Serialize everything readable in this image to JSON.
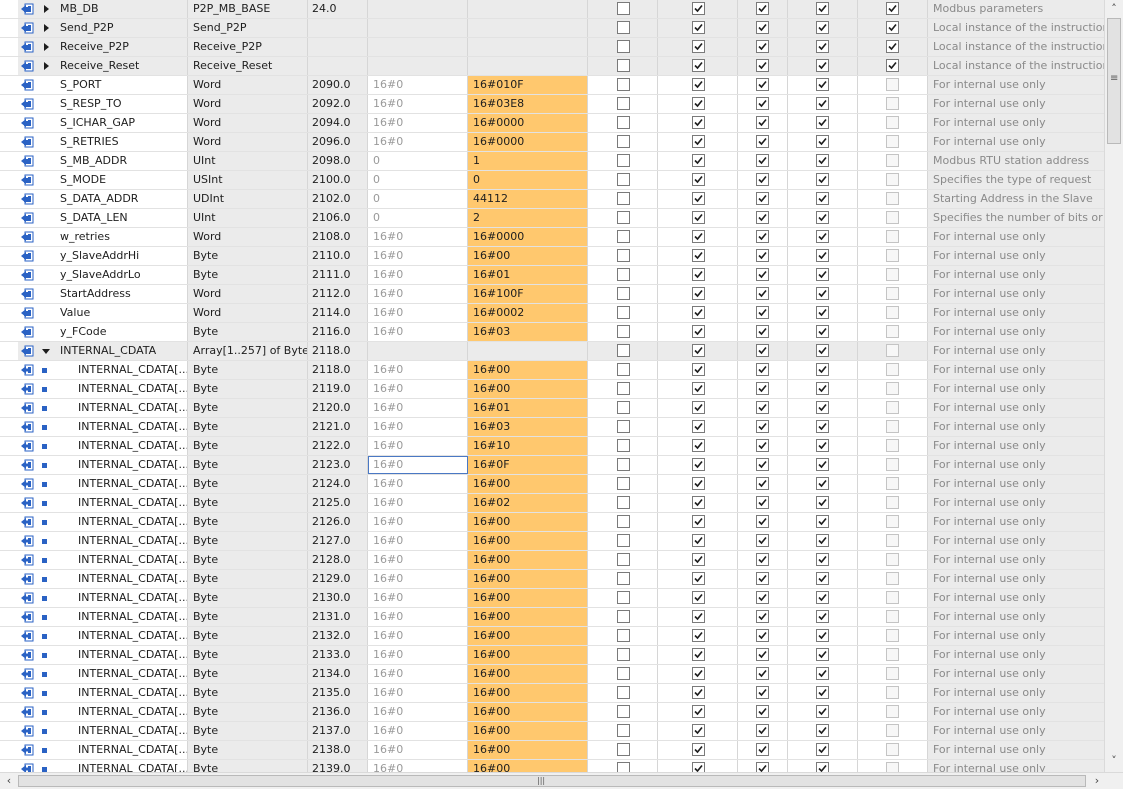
{
  "rows": [
    {
      "name": "MB_DB",
      "type": "P2P_MB_BASE",
      "offset": "24.0",
      "start": "",
      "snapshot": "",
      "expand": "right",
      "indent": 0,
      "checks": [
        false,
        true,
        true,
        true,
        true
      ],
      "setpoint_enabled": true,
      "comment": "Modbus parameters",
      "header": true
    },
    {
      "name": "Send_P2P",
      "type": "Send_P2P",
      "offset": "",
      "start": "",
      "snapshot": "",
      "expand": "right",
      "indent": 0,
      "checks": [
        false,
        true,
        true,
        true,
        true
      ],
      "setpoint_enabled": true,
      "comment": "Local instance of the instruction",
      "header": true
    },
    {
      "name": "Receive_P2P",
      "type": "Receive_P2P",
      "offset": "",
      "start": "",
      "snapshot": "",
      "expand": "right",
      "indent": 0,
      "checks": [
        false,
        true,
        true,
        true,
        true
      ],
      "setpoint_enabled": true,
      "comment": "Local instance of the instruction",
      "header": true
    },
    {
      "name": "Receive_Reset",
      "type": "Receive_Reset",
      "offset": "",
      "start": "",
      "snapshot": "",
      "expand": "right",
      "indent": 0,
      "checks": [
        false,
        true,
        true,
        true,
        true
      ],
      "setpoint_enabled": true,
      "comment": "Local instance of the instruction",
      "header": true
    },
    {
      "name": "S_PORT",
      "type": "Word",
      "offset": "2090.0",
      "start": "16#0",
      "snapshot": "16#010F",
      "expand": "",
      "indent": 0,
      "checks": [
        false,
        true,
        true,
        true,
        false
      ],
      "setpoint_enabled": false,
      "comment": "For internal use only"
    },
    {
      "name": "S_RESP_TO",
      "type": "Word",
      "offset": "2092.0",
      "start": "16#0",
      "snapshot": "16#03E8",
      "expand": "",
      "indent": 0,
      "checks": [
        false,
        true,
        true,
        true,
        false
      ],
      "setpoint_enabled": false,
      "comment": "For internal use only"
    },
    {
      "name": "S_ICHAR_GAP",
      "type": "Word",
      "offset": "2094.0",
      "start": "16#0",
      "snapshot": "16#0000",
      "expand": "",
      "indent": 0,
      "checks": [
        false,
        true,
        true,
        true,
        false
      ],
      "setpoint_enabled": false,
      "comment": "For internal use only"
    },
    {
      "name": "S_RETRIES",
      "type": "Word",
      "offset": "2096.0",
      "start": "16#0",
      "snapshot": "16#0000",
      "expand": "",
      "indent": 0,
      "checks": [
        false,
        true,
        true,
        true,
        false
      ],
      "setpoint_enabled": false,
      "comment": "For internal use only"
    },
    {
      "name": "S_MB_ADDR",
      "type": "UInt",
      "offset": "2098.0",
      "start": "0",
      "snapshot": "1",
      "expand": "",
      "indent": 0,
      "checks": [
        false,
        true,
        true,
        true,
        false
      ],
      "setpoint_enabled": false,
      "comment": "Modbus RTU station address"
    },
    {
      "name": "S_MODE",
      "type": "USInt",
      "offset": "2100.0",
      "start": "0",
      "snapshot": "0",
      "expand": "",
      "indent": 0,
      "checks": [
        false,
        true,
        true,
        true,
        false
      ],
      "setpoint_enabled": false,
      "comment": "Specifies the type of request"
    },
    {
      "name": "S_DATA_ADDR",
      "type": "UDInt",
      "offset": "2102.0",
      "start": "0",
      "snapshot": "44112",
      "expand": "",
      "indent": 0,
      "checks": [
        false,
        true,
        true,
        true,
        false
      ],
      "setpoint_enabled": false,
      "comment": "Starting Address in the Slave"
    },
    {
      "name": "S_DATA_LEN",
      "type": "UInt",
      "offset": "2106.0",
      "start": "0",
      "snapshot": "2",
      "expand": "",
      "indent": 0,
      "checks": [
        false,
        true,
        true,
        true,
        false
      ],
      "setpoint_enabled": false,
      "comment": "Specifies the number of bits or w"
    },
    {
      "name": "w_retries",
      "type": "Word",
      "offset": "2108.0",
      "start": "16#0",
      "snapshot": "16#0000",
      "expand": "",
      "indent": 0,
      "checks": [
        false,
        true,
        true,
        true,
        false
      ],
      "setpoint_enabled": false,
      "comment": "For internal use only"
    },
    {
      "name": "y_SlaveAddrHi",
      "type": "Byte",
      "offset": "2110.0",
      "start": "16#0",
      "snapshot": "16#00",
      "expand": "",
      "indent": 0,
      "checks": [
        false,
        true,
        true,
        true,
        false
      ],
      "setpoint_enabled": false,
      "comment": "For internal use only"
    },
    {
      "name": "y_SlaveAddrLo",
      "type": "Byte",
      "offset": "2111.0",
      "start": "16#0",
      "snapshot": "16#01",
      "expand": "",
      "indent": 0,
      "checks": [
        false,
        true,
        true,
        true,
        false
      ],
      "setpoint_enabled": false,
      "comment": "For internal use only"
    },
    {
      "name": "StartAddress",
      "type": "Word",
      "offset": "2112.0",
      "start": "16#0",
      "snapshot": "16#100F",
      "expand": "",
      "indent": 0,
      "checks": [
        false,
        true,
        true,
        true,
        false
      ],
      "setpoint_enabled": false,
      "comment": "For internal use only"
    },
    {
      "name": "Value",
      "type": "Word",
      "offset": "2114.0",
      "start": "16#0",
      "snapshot": "16#0002",
      "expand": "",
      "indent": 0,
      "checks": [
        false,
        true,
        true,
        true,
        false
      ],
      "setpoint_enabled": false,
      "comment": "For internal use only"
    },
    {
      "name": "y_FCode",
      "type": "Byte",
      "offset": "2116.0",
      "start": "16#0",
      "snapshot": "16#03",
      "expand": "",
      "indent": 0,
      "checks": [
        false,
        true,
        true,
        true,
        false
      ],
      "setpoint_enabled": false,
      "comment": "For internal use only"
    },
    {
      "name": "INTERNAL_CDATA",
      "type": "Array[1..257] of Byte",
      "offset": "2118.0",
      "start": "",
      "snapshot": "",
      "expand": "down",
      "indent": 0,
      "checks": [
        false,
        true,
        true,
        true,
        false
      ],
      "setpoint_enabled": false,
      "comment": "For internal use only",
      "header": true
    },
    {
      "name": "INTERNAL_CDATA[...",
      "type": "Byte",
      "offset": "2118.0",
      "start": "16#0",
      "snapshot": "16#00",
      "expand": "",
      "indent": 1,
      "checks": [
        false,
        true,
        true,
        true,
        false
      ],
      "setpoint_enabled": false,
      "comment": "For internal use only"
    },
    {
      "name": "INTERNAL_CDATA[...",
      "type": "Byte",
      "offset": "2119.0",
      "start": "16#0",
      "snapshot": "16#00",
      "expand": "",
      "indent": 1,
      "checks": [
        false,
        true,
        true,
        true,
        false
      ],
      "setpoint_enabled": false,
      "comment": "For internal use only"
    },
    {
      "name": "INTERNAL_CDATA[...",
      "type": "Byte",
      "offset": "2120.0",
      "start": "16#0",
      "snapshot": "16#01",
      "expand": "",
      "indent": 1,
      "checks": [
        false,
        true,
        true,
        true,
        false
      ],
      "setpoint_enabled": false,
      "comment": "For internal use only"
    },
    {
      "name": "INTERNAL_CDATA[...",
      "type": "Byte",
      "offset": "2121.0",
      "start": "16#0",
      "snapshot": "16#03",
      "expand": "",
      "indent": 1,
      "checks": [
        false,
        true,
        true,
        true,
        false
      ],
      "setpoint_enabled": false,
      "comment": "For internal use only"
    },
    {
      "name": "INTERNAL_CDATA[...",
      "type": "Byte",
      "offset": "2122.0",
      "start": "16#0",
      "snapshot": "16#10",
      "expand": "",
      "indent": 1,
      "checks": [
        false,
        true,
        true,
        true,
        false
      ],
      "setpoint_enabled": false,
      "comment": "For internal use only"
    },
    {
      "name": "INTERNAL_CDATA[...",
      "type": "Byte",
      "offset": "2123.0",
      "start": "16#0",
      "snapshot": "16#0F",
      "expand": "",
      "indent": 1,
      "checks": [
        false,
        true,
        true,
        true,
        false
      ],
      "setpoint_enabled": false,
      "comment": "For internal use only",
      "selected": true
    },
    {
      "name": "INTERNAL_CDATA[...",
      "type": "Byte",
      "offset": "2124.0",
      "start": "16#0",
      "snapshot": "16#00",
      "expand": "",
      "indent": 1,
      "checks": [
        false,
        true,
        true,
        true,
        false
      ],
      "setpoint_enabled": false,
      "comment": "For internal use only"
    },
    {
      "name": "INTERNAL_CDATA[...",
      "type": "Byte",
      "offset": "2125.0",
      "start": "16#0",
      "snapshot": "16#02",
      "expand": "",
      "indent": 1,
      "checks": [
        false,
        true,
        true,
        true,
        false
      ],
      "setpoint_enabled": false,
      "comment": "For internal use only"
    },
    {
      "name": "INTERNAL_CDATA[...",
      "type": "Byte",
      "offset": "2126.0",
      "start": "16#0",
      "snapshot": "16#00",
      "expand": "",
      "indent": 1,
      "checks": [
        false,
        true,
        true,
        true,
        false
      ],
      "setpoint_enabled": false,
      "comment": "For internal use only"
    },
    {
      "name": "INTERNAL_CDATA[...",
      "type": "Byte",
      "offset": "2127.0",
      "start": "16#0",
      "snapshot": "16#00",
      "expand": "",
      "indent": 1,
      "checks": [
        false,
        true,
        true,
        true,
        false
      ],
      "setpoint_enabled": false,
      "comment": "For internal use only"
    },
    {
      "name": "INTERNAL_CDATA[...",
      "type": "Byte",
      "offset": "2128.0",
      "start": "16#0",
      "snapshot": "16#00",
      "expand": "",
      "indent": 1,
      "checks": [
        false,
        true,
        true,
        true,
        false
      ],
      "setpoint_enabled": false,
      "comment": "For internal use only"
    },
    {
      "name": "INTERNAL_CDATA[...",
      "type": "Byte",
      "offset": "2129.0",
      "start": "16#0",
      "snapshot": "16#00",
      "expand": "",
      "indent": 1,
      "checks": [
        false,
        true,
        true,
        true,
        false
      ],
      "setpoint_enabled": false,
      "comment": "For internal use only"
    },
    {
      "name": "INTERNAL_CDATA[...",
      "type": "Byte",
      "offset": "2130.0",
      "start": "16#0",
      "snapshot": "16#00",
      "expand": "",
      "indent": 1,
      "checks": [
        false,
        true,
        true,
        true,
        false
      ],
      "setpoint_enabled": false,
      "comment": "For internal use only"
    },
    {
      "name": "INTERNAL_CDATA[...",
      "type": "Byte",
      "offset": "2131.0",
      "start": "16#0",
      "snapshot": "16#00",
      "expand": "",
      "indent": 1,
      "checks": [
        false,
        true,
        true,
        true,
        false
      ],
      "setpoint_enabled": false,
      "comment": "For internal use only"
    },
    {
      "name": "INTERNAL_CDATA[...",
      "type": "Byte",
      "offset": "2132.0",
      "start": "16#0",
      "snapshot": "16#00",
      "expand": "",
      "indent": 1,
      "checks": [
        false,
        true,
        true,
        true,
        false
      ],
      "setpoint_enabled": false,
      "comment": "For internal use only"
    },
    {
      "name": "INTERNAL_CDATA[...",
      "type": "Byte",
      "offset": "2133.0",
      "start": "16#0",
      "snapshot": "16#00",
      "expand": "",
      "indent": 1,
      "checks": [
        false,
        true,
        true,
        true,
        false
      ],
      "setpoint_enabled": false,
      "comment": "For internal use only"
    },
    {
      "name": "INTERNAL_CDATA[...",
      "type": "Byte",
      "offset": "2134.0",
      "start": "16#0",
      "snapshot": "16#00",
      "expand": "",
      "indent": 1,
      "checks": [
        false,
        true,
        true,
        true,
        false
      ],
      "setpoint_enabled": false,
      "comment": "For internal use only"
    },
    {
      "name": "INTERNAL_CDATA[...",
      "type": "Byte",
      "offset": "2135.0",
      "start": "16#0",
      "snapshot": "16#00",
      "expand": "",
      "indent": 1,
      "checks": [
        false,
        true,
        true,
        true,
        false
      ],
      "setpoint_enabled": false,
      "comment": "For internal use only"
    },
    {
      "name": "INTERNAL_CDATA[...",
      "type": "Byte",
      "offset": "2136.0",
      "start": "16#0",
      "snapshot": "16#00",
      "expand": "",
      "indent": 1,
      "checks": [
        false,
        true,
        true,
        true,
        false
      ],
      "setpoint_enabled": false,
      "comment": "For internal use only"
    },
    {
      "name": "INTERNAL_CDATA[...",
      "type": "Byte",
      "offset": "2137.0",
      "start": "16#0",
      "snapshot": "16#00",
      "expand": "",
      "indent": 1,
      "checks": [
        false,
        true,
        true,
        true,
        false
      ],
      "setpoint_enabled": false,
      "comment": "For internal use only"
    },
    {
      "name": "INTERNAL_CDATA[...",
      "type": "Byte",
      "offset": "2138.0",
      "start": "16#0",
      "snapshot": "16#00",
      "expand": "",
      "indent": 1,
      "checks": [
        false,
        true,
        true,
        true,
        false
      ],
      "setpoint_enabled": false,
      "comment": "For internal use only"
    },
    {
      "name": "INTERNAL_CDATA[...",
      "type": "Byte",
      "offset": "2139.0",
      "start": "16#0",
      "snapshot": "16#00",
      "expand": "",
      "indent": 1,
      "checks": [
        false,
        true,
        true,
        true,
        false
      ],
      "setpoint_enabled": false,
      "comment": "For internal use only"
    }
  ],
  "colors": {
    "snapshot_highlight": "#ffc86e",
    "bullet": "#2a62c4",
    "interface_icon": "#2a62c4",
    "check": "#1e1e1e"
  },
  "icons": {
    "interface": "interface-in-icon",
    "expand_right": "chevron-right-icon",
    "expand_down": "chevron-down-icon",
    "member": "member-bullet-icon",
    "checkbox": "checkbox-icon"
  },
  "scrollbars": {
    "vertical_grip": "≡",
    "horizontal_grip": "|||",
    "left_arrow": "‹",
    "right_arrow": "›",
    "up_arrow": "˄",
    "down_arrow": "˅"
  }
}
